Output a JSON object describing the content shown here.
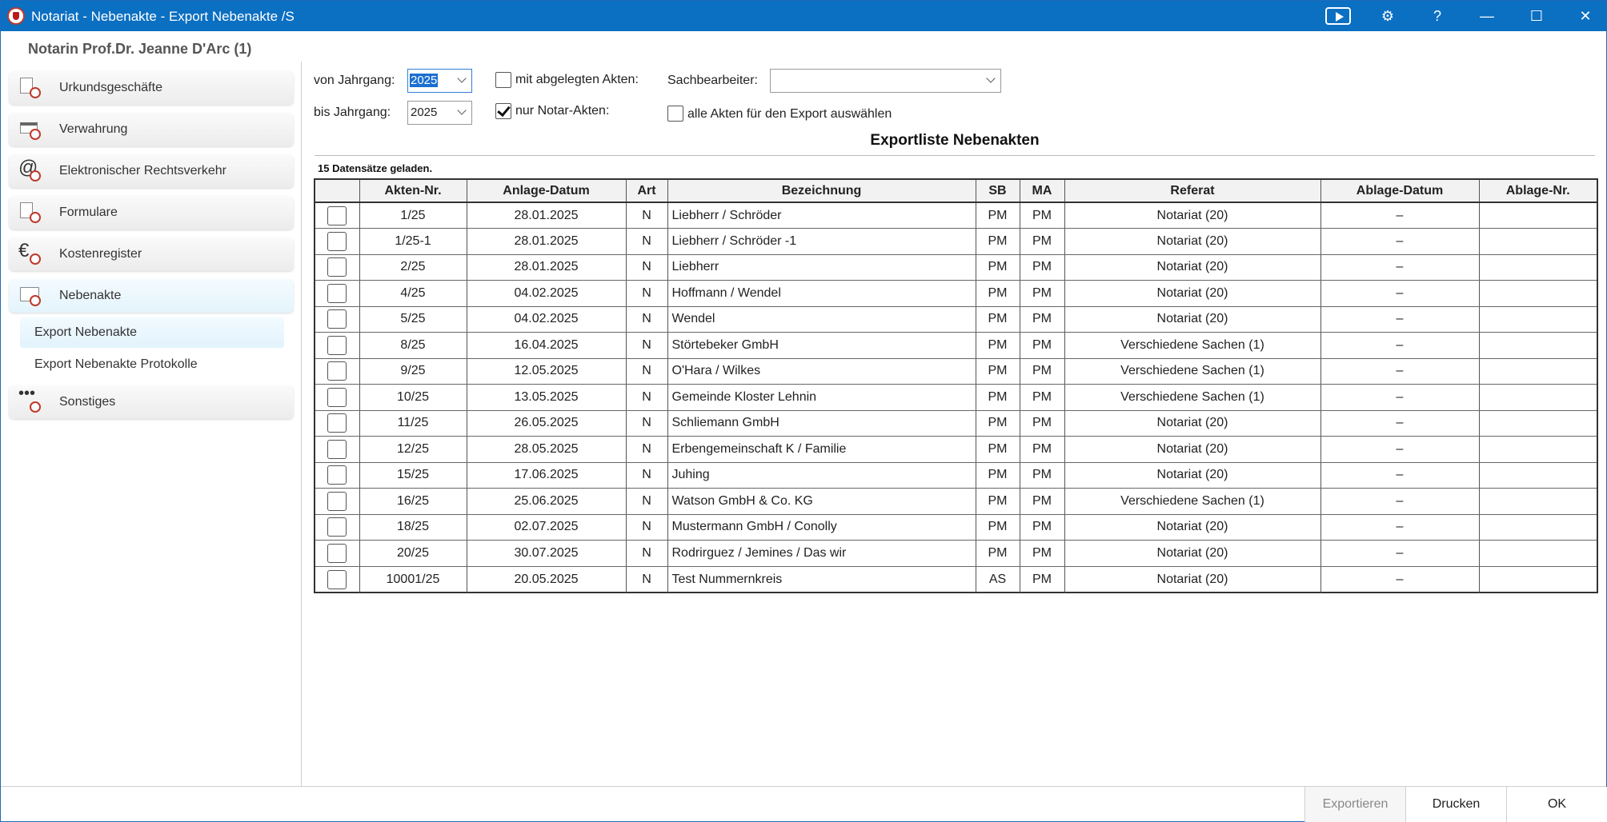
{
  "window": {
    "title": "Notariat - Nebenakte - Export Nebenakte /S",
    "buttons": {
      "settings": "⚙",
      "help": "?",
      "minimize": "—",
      "maximize": "☐",
      "close": "✕"
    }
  },
  "header": {
    "notary": "Notarin Prof.Dr. Jeanne D'Arc (1)"
  },
  "sidebar": {
    "items": [
      {
        "label": "Urkundsgeschäfte",
        "icon": "document-seal-icon"
      },
      {
        "label": "Verwahrung",
        "icon": "card-seal-icon"
      },
      {
        "label": "Elektronischer Rechtsverkehr",
        "icon": "at-seal-icon"
      },
      {
        "label": "Formulare",
        "icon": "document-seal-icon"
      },
      {
        "label": "Kostenregister",
        "icon": "euro-seal-icon"
      },
      {
        "label": "Nebenakte",
        "icon": "folder-seal-icon"
      },
      {
        "label": "Sonstiges",
        "icon": "dots-seal-icon"
      }
    ],
    "subitems": [
      {
        "label": "Export Nebenakte"
      },
      {
        "label": "Export Nebenakte Protokolle"
      }
    ]
  },
  "filters": {
    "von_label": "von Jahrgang:",
    "von_value": "2025",
    "bis_label": "bis Jahrgang:",
    "bis_value": "2025",
    "abgelegt_label": "mit abgelegten Akten:",
    "abgelegt_checked": false,
    "notar_label": "nur Notar-Akten:",
    "notar_checked": true,
    "sachbearbeiter_label": "Sachbearbeiter:",
    "sachbearbeiter_value": "",
    "alle_label": "alle Akten für den Export auswählen",
    "alle_checked": false
  },
  "list": {
    "title": "Exportliste Nebenakten",
    "status": "15 Datensätze geladen.",
    "columns": [
      "",
      "Akten-Nr.",
      "Anlage-Datum",
      "Art",
      "Bezeichnung",
      "SB",
      "MA",
      "Referat",
      "Ablage-Datum",
      "Ablage-Nr."
    ],
    "rows": [
      [
        "1/25",
        "28.01.2025",
        "N",
        "Liebherr / Schröder",
        "PM",
        "PM",
        "Notariat (20)",
        "–",
        ""
      ],
      [
        "1/25-1",
        "28.01.2025",
        "N",
        "Liebherr / Schröder -1",
        "PM",
        "PM",
        "Notariat (20)",
        "–",
        ""
      ],
      [
        "2/25",
        "28.01.2025",
        "N",
        "Liebherr",
        "PM",
        "PM",
        "Notariat (20)",
        "–",
        ""
      ],
      [
        "4/25",
        "04.02.2025",
        "N",
        "Hoffmann / Wendel",
        "PM",
        "PM",
        "Notariat (20)",
        "–",
        ""
      ],
      [
        "5/25",
        "04.02.2025",
        "N",
        "Wendel",
        "PM",
        "PM",
        "Notariat (20)",
        "–",
        ""
      ],
      [
        "8/25",
        "16.04.2025",
        "N",
        "Störtebeker GmbH",
        "PM",
        "PM",
        "Verschiedene Sachen (1)",
        "–",
        ""
      ],
      [
        "9/25",
        "12.05.2025",
        "N",
        "O'Hara / Wilkes",
        "PM",
        "PM",
        "Verschiedene Sachen (1)",
        "–",
        ""
      ],
      [
        "10/25",
        "13.05.2025",
        "N",
        "Gemeinde Kloster Lehnin",
        "PM",
        "PM",
        "Verschiedene Sachen (1)",
        "–",
        ""
      ],
      [
        "11/25",
        "26.05.2025",
        "N",
        "Schliemann GmbH",
        "PM",
        "PM",
        "Notariat (20)",
        "–",
        ""
      ],
      [
        "12/25",
        "28.05.2025",
        "N",
        "Erbengemeinschaft K / Familie",
        "PM",
        "PM",
        "Notariat (20)",
        "–",
        ""
      ],
      [
        "15/25",
        "17.06.2025",
        "N",
        "Juhing",
        "PM",
        "PM",
        "Notariat (20)",
        "–",
        ""
      ],
      [
        "16/25",
        "25.06.2025",
        "N",
        "Watson GmbH & Co. KG",
        "PM",
        "PM",
        "Verschiedene Sachen (1)",
        "–",
        ""
      ],
      [
        "18/25",
        "02.07.2025",
        "N",
        "Mustermann GmbH / Conolly",
        "PM",
        "PM",
        "Notariat (20)",
        "–",
        ""
      ],
      [
        "20/25",
        "30.07.2025",
        "N",
        "Rodrirguez / Jemines / Das wir",
        "PM",
        "PM",
        "Notariat (20)",
        "–",
        ""
      ],
      [
        "10001/25",
        "20.05.2025",
        "N",
        "Test Nummernkreis",
        "AS",
        "PM",
        "Notariat (20)",
        "–",
        ""
      ]
    ]
  },
  "footer": {
    "export_label": "Exportieren",
    "print_label": "Drucken",
    "ok_label": "OK"
  },
  "colors": {
    "titlebar": "#0b6fc2",
    "accent": "#1a6fd1",
    "seal": "#c0392b"
  }
}
